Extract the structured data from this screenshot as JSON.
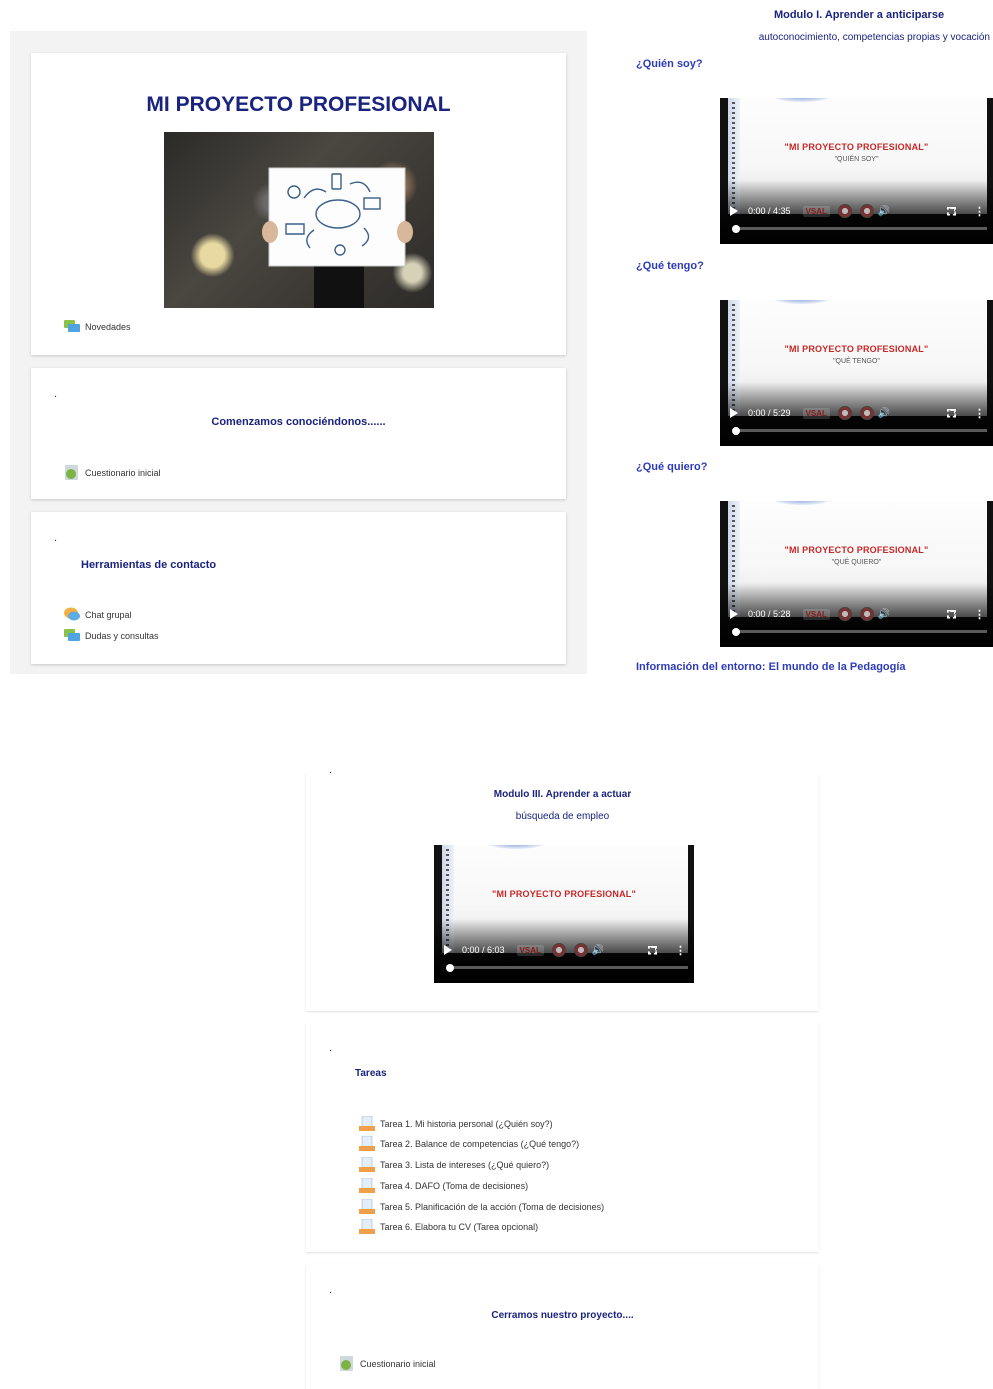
{
  "course": {
    "title": "MI PROYECTO PROFESIONAL",
    "announcements_label": "Novedades"
  },
  "section_intro": {
    "dot": ".",
    "title": "Comenzamos conociéndonos......",
    "quiz_label": "Cuestionario inicial"
  },
  "section_contact": {
    "dot": ".",
    "title": "Herramientas de contacto",
    "items": [
      "Chat grupal",
      "Dudas y consultas"
    ]
  },
  "module1": {
    "title": "Modulo I. Aprender a anticiparse",
    "subtitle": "autoconocimiento, competencias propias y vocación",
    "videos": [
      {
        "heading": "¿Quién soy?",
        "slide_title": "\"MI PROYECTO PROFESIONAL\"",
        "slide_sub": "\"QUIÉN SOY\"",
        "time": "0:00 / 4:35"
      },
      {
        "heading": "¿Qué tengo?",
        "slide_title": "\"MI PROYECTO PROFESIONAL\"",
        "slide_sub": "\"QUÉ TENGO\"",
        "time": "0:00 / 5:29"
      },
      {
        "heading": "¿Qué quiero?",
        "slide_title": "\"MI PROYECTO PROFESIONAL\"",
        "slide_sub": "\"QUÉ QUIERO\"",
        "time": "0:00 / 5:28"
      }
    ],
    "next_heading": "Información del entorno: El mundo de la Pedagogía"
  },
  "module3": {
    "dot": ".",
    "title": "Modulo III. Aprender a actuar",
    "subtitle": "búsqueda de empleo",
    "video": {
      "slide_title": "\"MI PROYECTO PROFESIONAL\"",
      "slide_sub": "",
      "time": "0:00 / 6:03"
    }
  },
  "section_tasks": {
    "dot": ".",
    "title": "Tareas",
    "items": [
      "Tarea 1. Mi historia personal (¿Quién soy?)",
      "Tarea 2. Balance de competencias (¿Qué tengo?)",
      "Tarea 3. Lista de intereses (¿Qué quiero?)",
      "Tarea 4. DAFO (Toma de decisiones)",
      "Tarea 5. Planificación de la acción (Toma de decisiones)",
      "Tarea 6. Elabora tu CV (Tarea opcional)"
    ]
  },
  "section_close": {
    "dot": ".",
    "title": "Cerramos nuestro proyecto....",
    "quiz_label": "Cuestionario inicial"
  },
  "video_logo_text": "VSAL",
  "colors": {
    "accent": "#1a237e",
    "link": "#2e3bb8",
    "slide_red": "#c62828"
  }
}
